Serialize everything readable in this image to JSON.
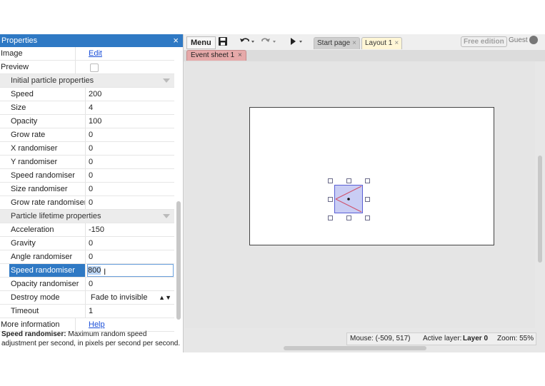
{
  "panel": {
    "title": "Properties",
    "close": "×",
    "rows_top": [
      {
        "label": "Image",
        "value": "Edit",
        "type": "link"
      },
      {
        "label": "Preview",
        "value": "",
        "type": "checkbox"
      }
    ],
    "section1": "Initial particle properties",
    "initial": [
      {
        "label": "Speed",
        "value": "200"
      },
      {
        "label": "Size",
        "value": "4"
      },
      {
        "label": "Opacity",
        "value": "100"
      },
      {
        "label": "Grow rate",
        "value": "0"
      },
      {
        "label": "X randomiser",
        "value": "0"
      },
      {
        "label": "Y randomiser",
        "value": "0"
      },
      {
        "label": "Speed randomiser",
        "value": "0"
      },
      {
        "label": "Size randomiser",
        "value": "0"
      },
      {
        "label": "Grow rate randomiser",
        "value": "0"
      }
    ],
    "section2": "Particle lifetime properties",
    "lifetime": [
      {
        "label": "Acceleration",
        "value": "-150"
      },
      {
        "label": "Gravity",
        "value": "0"
      },
      {
        "label": "Angle randomiser",
        "value": "0"
      },
      {
        "label": "Speed randomiser",
        "value": "800",
        "selected": true
      },
      {
        "label": "Opacity randomiser",
        "value": "0"
      },
      {
        "label": "Destroy mode",
        "value": "Fade to invisible",
        "type": "select"
      },
      {
        "label": "Timeout",
        "value": "1"
      }
    ],
    "more_info": {
      "label": "More information",
      "value": "Help"
    },
    "description_title": "Speed randomiser:",
    "description_text": "Maximum random speed adjustment per second, in pixels per second per second."
  },
  "toolbar": {
    "menu": "Menu",
    "save_icon": "floppy-icon",
    "undo_icon": "undo-icon",
    "redo_icon": "redo-icon",
    "run_icon": "play-icon",
    "tabs": [
      {
        "label": "Start page",
        "close": "×"
      },
      {
        "label": "Layout 1",
        "close": "×"
      }
    ],
    "edition": "Free edition",
    "user": "Guest"
  },
  "subtabs": [
    {
      "label": "Event sheet 1",
      "close": "×"
    }
  ],
  "status": {
    "mouse": "Mouse: (-509, 517)",
    "layer_prefix": "Active layer:",
    "layer": "Layer 0",
    "zoom": "Zoom: 55%"
  }
}
